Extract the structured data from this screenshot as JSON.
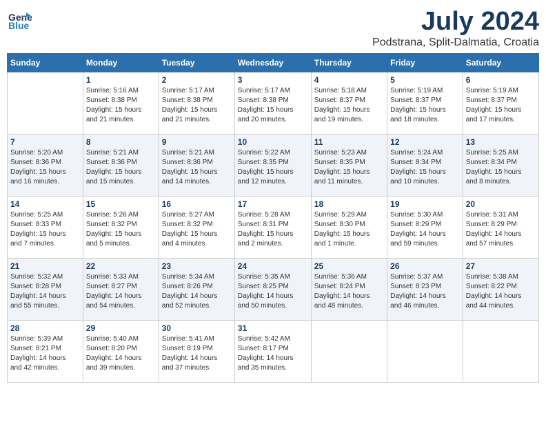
{
  "header": {
    "logo_line1": "General",
    "logo_line2": "Blue",
    "month_year": "July 2024",
    "location": "Podstrana, Split-Dalmatia, Croatia"
  },
  "weekdays": [
    "Sunday",
    "Monday",
    "Tuesday",
    "Wednesday",
    "Thursday",
    "Friday",
    "Saturday"
  ],
  "weeks": [
    [
      {
        "day": "",
        "info": ""
      },
      {
        "day": "1",
        "info": "Sunrise: 5:16 AM\nSunset: 8:38 PM\nDaylight: 15 hours\nand 21 minutes."
      },
      {
        "day": "2",
        "info": "Sunrise: 5:17 AM\nSunset: 8:38 PM\nDaylight: 15 hours\nand 21 minutes."
      },
      {
        "day": "3",
        "info": "Sunrise: 5:17 AM\nSunset: 8:38 PM\nDaylight: 15 hours\nand 20 minutes."
      },
      {
        "day": "4",
        "info": "Sunrise: 5:18 AM\nSunset: 8:37 PM\nDaylight: 15 hours\nand 19 minutes."
      },
      {
        "day": "5",
        "info": "Sunrise: 5:19 AM\nSunset: 8:37 PM\nDaylight: 15 hours\nand 18 minutes."
      },
      {
        "day": "6",
        "info": "Sunrise: 5:19 AM\nSunset: 8:37 PM\nDaylight: 15 hours\nand 17 minutes."
      }
    ],
    [
      {
        "day": "7",
        "info": "Sunrise: 5:20 AM\nSunset: 8:36 PM\nDaylight: 15 hours\nand 16 minutes."
      },
      {
        "day": "8",
        "info": "Sunrise: 5:21 AM\nSunset: 8:36 PM\nDaylight: 15 hours\nand 15 minutes."
      },
      {
        "day": "9",
        "info": "Sunrise: 5:21 AM\nSunset: 8:36 PM\nDaylight: 15 hours\nand 14 minutes."
      },
      {
        "day": "10",
        "info": "Sunrise: 5:22 AM\nSunset: 8:35 PM\nDaylight: 15 hours\nand 12 minutes."
      },
      {
        "day": "11",
        "info": "Sunrise: 5:23 AM\nSunset: 8:35 PM\nDaylight: 15 hours\nand 11 minutes."
      },
      {
        "day": "12",
        "info": "Sunrise: 5:24 AM\nSunset: 8:34 PM\nDaylight: 15 hours\nand 10 minutes."
      },
      {
        "day": "13",
        "info": "Sunrise: 5:25 AM\nSunset: 8:34 PM\nDaylight: 15 hours\nand 8 minutes."
      }
    ],
    [
      {
        "day": "14",
        "info": "Sunrise: 5:25 AM\nSunset: 8:33 PM\nDaylight: 15 hours\nand 7 minutes."
      },
      {
        "day": "15",
        "info": "Sunrise: 5:26 AM\nSunset: 8:32 PM\nDaylight: 15 hours\nand 5 minutes."
      },
      {
        "day": "16",
        "info": "Sunrise: 5:27 AM\nSunset: 8:32 PM\nDaylight: 15 hours\nand 4 minutes."
      },
      {
        "day": "17",
        "info": "Sunrise: 5:28 AM\nSunset: 8:31 PM\nDaylight: 15 hours\nand 2 minutes."
      },
      {
        "day": "18",
        "info": "Sunrise: 5:29 AM\nSunset: 8:30 PM\nDaylight: 15 hours\nand 1 minute."
      },
      {
        "day": "19",
        "info": "Sunrise: 5:30 AM\nSunset: 8:29 PM\nDaylight: 14 hours\nand 59 minutes."
      },
      {
        "day": "20",
        "info": "Sunrise: 5:31 AM\nSunset: 8:29 PM\nDaylight: 14 hours\nand 57 minutes."
      }
    ],
    [
      {
        "day": "21",
        "info": "Sunrise: 5:32 AM\nSunset: 8:28 PM\nDaylight: 14 hours\nand 55 minutes."
      },
      {
        "day": "22",
        "info": "Sunrise: 5:33 AM\nSunset: 8:27 PM\nDaylight: 14 hours\nand 54 minutes."
      },
      {
        "day": "23",
        "info": "Sunrise: 5:34 AM\nSunset: 8:26 PM\nDaylight: 14 hours\nand 52 minutes."
      },
      {
        "day": "24",
        "info": "Sunrise: 5:35 AM\nSunset: 8:25 PM\nDaylight: 14 hours\nand 50 minutes."
      },
      {
        "day": "25",
        "info": "Sunrise: 5:36 AM\nSunset: 8:24 PM\nDaylight: 14 hours\nand 48 minutes."
      },
      {
        "day": "26",
        "info": "Sunrise: 5:37 AM\nSunset: 8:23 PM\nDaylight: 14 hours\nand 46 minutes."
      },
      {
        "day": "27",
        "info": "Sunrise: 5:38 AM\nSunset: 8:22 PM\nDaylight: 14 hours\nand 44 minutes."
      }
    ],
    [
      {
        "day": "28",
        "info": "Sunrise: 5:39 AM\nSunset: 8:21 PM\nDaylight: 14 hours\nand 42 minutes."
      },
      {
        "day": "29",
        "info": "Sunrise: 5:40 AM\nSunset: 8:20 PM\nDaylight: 14 hours\nand 39 minutes."
      },
      {
        "day": "30",
        "info": "Sunrise: 5:41 AM\nSunset: 8:19 PM\nDaylight: 14 hours\nand 37 minutes."
      },
      {
        "day": "31",
        "info": "Sunrise: 5:42 AM\nSunset: 8:17 PM\nDaylight: 14 hours\nand 35 minutes."
      },
      {
        "day": "",
        "info": ""
      },
      {
        "day": "",
        "info": ""
      },
      {
        "day": "",
        "info": ""
      }
    ]
  ]
}
